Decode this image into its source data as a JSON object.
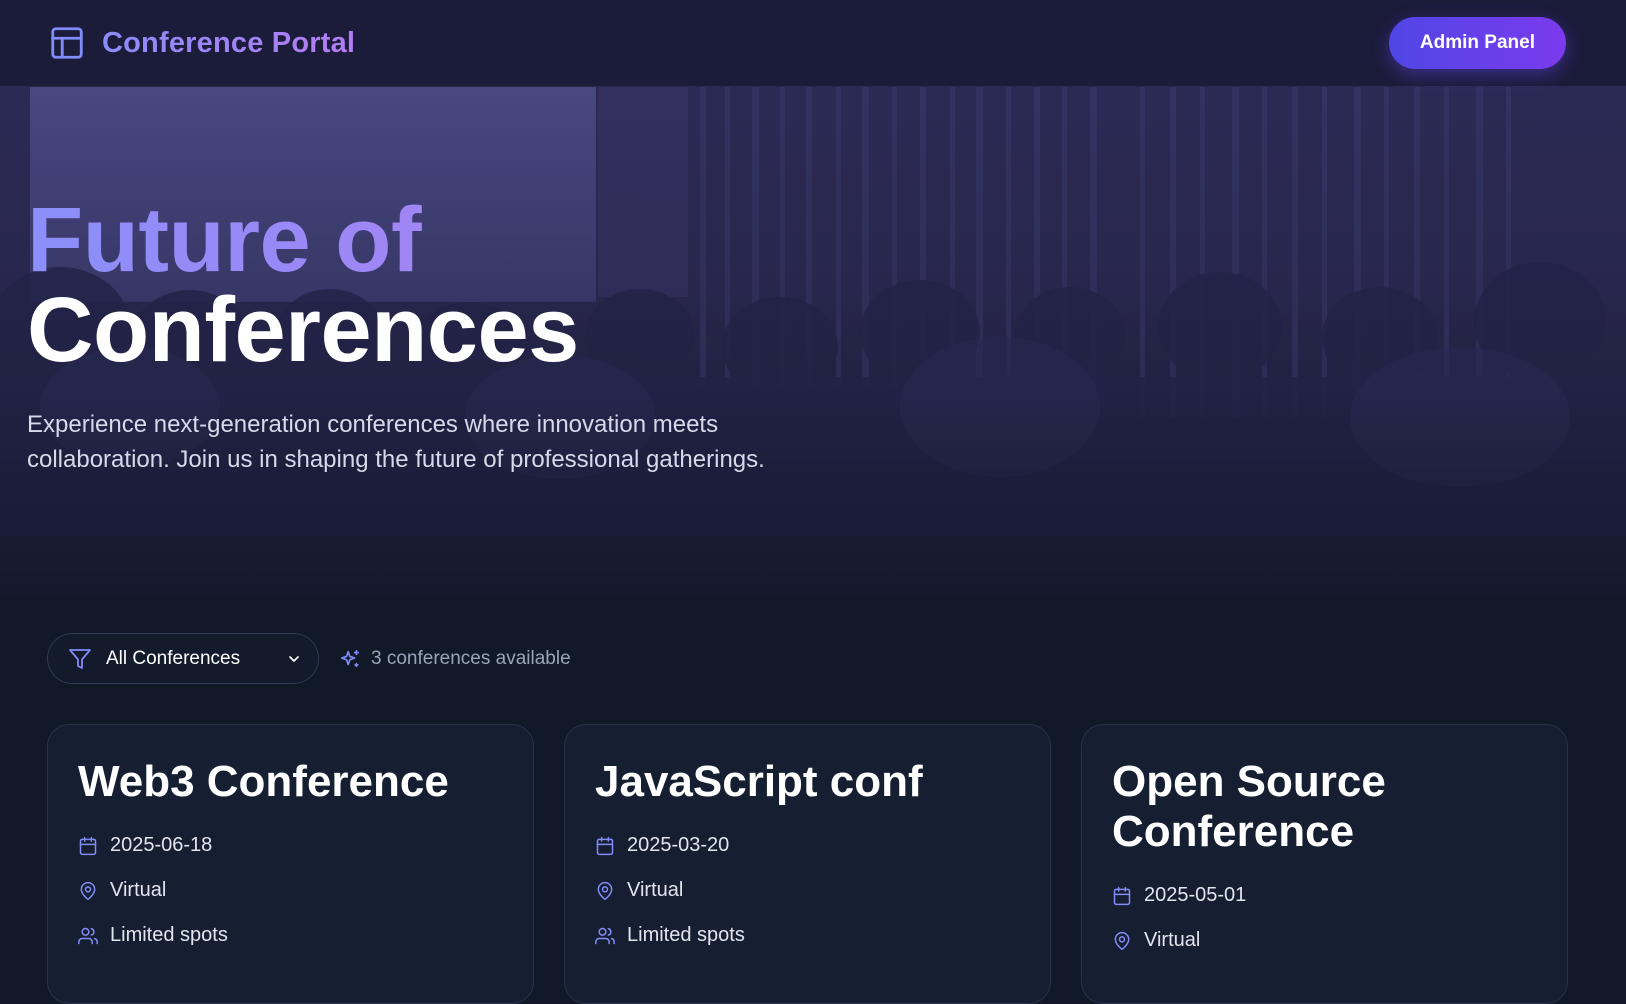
{
  "nav": {
    "brand_title": "Conference Portal",
    "admin_button": "Admin Panel"
  },
  "hero": {
    "title_line1": "Future of",
    "title_line2": "Conferences",
    "subtitle": "Experience next-generation conferences where innovation meets collaboration. Join us in shaping the future of professional gatherings."
  },
  "filters": {
    "select_value": "All Conferences",
    "count_text": "3 conferences available"
  },
  "cards": [
    {
      "title": "Web3 Conference",
      "date": "2025-06-18",
      "location": "Virtual",
      "capacity": "Limited spots"
    },
    {
      "title": "JavaScript conf",
      "date": "2025-03-20",
      "location": "Virtual",
      "capacity": "Limited spots"
    },
    {
      "title": "Open Source Conference",
      "date": "2025-05-01",
      "location": "Virtual"
    }
  ],
  "icons": {
    "brand": "layout-icon",
    "filter": "filter-icon",
    "dropdown": "chevron-down-icon",
    "count": "sparkles-icon",
    "date": "calendar-icon",
    "location": "map-pin-icon",
    "capacity": "users-icon"
  },
  "colors": {
    "accent_start": "#4f46e5",
    "accent_end": "#7c3aed",
    "icon": "#818cf8",
    "background": "#111827"
  }
}
